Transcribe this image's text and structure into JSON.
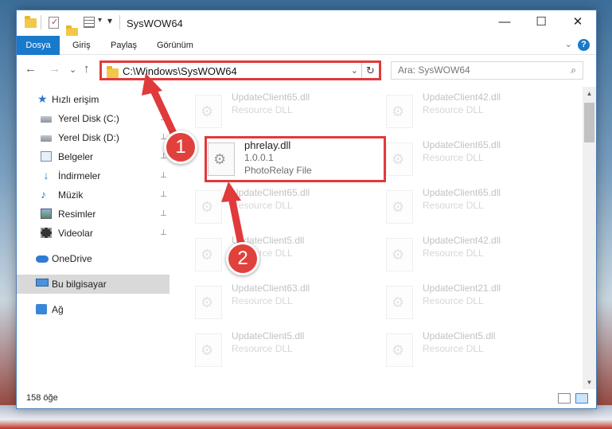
{
  "window": {
    "title": "SysWOW64",
    "minimize_glyph": "—",
    "maximize_glyph": "☐",
    "close_glyph": "✕"
  },
  "ribbon": {
    "tabs": [
      {
        "label": "Dosya",
        "active": true
      },
      {
        "label": "Giriş"
      },
      {
        "label": "Paylaş"
      },
      {
        "label": "Görünüm"
      }
    ],
    "help_glyph": "?",
    "expand_glyph": "⌄"
  },
  "nav": {
    "back_glyph": "←",
    "forward_glyph": "→",
    "recent_glyph": "⌄",
    "up_glyph": "↑"
  },
  "address": {
    "path": "C:\\Windows\\SysWOW64",
    "dropdown_glyph": "⌄",
    "refresh_glyph": "↻"
  },
  "search": {
    "placeholder": "Ara: SysWOW64",
    "icon_glyph": "⌕"
  },
  "sidebar": {
    "items": [
      {
        "label": "Hızlı erişim",
        "icon": "star-icon"
      },
      {
        "label": "Yerel Disk (C:)",
        "icon": "disk-icon",
        "pinned": true
      },
      {
        "label": "Yerel Disk (D:)",
        "icon": "disk-icon",
        "pinned": true
      },
      {
        "label": "Belgeler",
        "icon": "documents-icon",
        "pinned": true
      },
      {
        "label": "İndirmeler",
        "icon": "downloads-icon",
        "pinned": true
      },
      {
        "label": "Müzik",
        "icon": "music-icon",
        "pinned": true
      },
      {
        "label": "Resimler",
        "icon": "pictures-icon",
        "pinned": true
      },
      {
        "label": "Videolar",
        "icon": "videos-icon",
        "pinned": true
      },
      {
        "label": "OneDrive",
        "icon": "onedrive-icon"
      },
      {
        "label": "Bu bilgisayar",
        "icon": "this-pc-icon",
        "selected": true
      },
      {
        "label": "Ağ",
        "icon": "network-icon"
      }
    ],
    "pin_glyph": "📌"
  },
  "files": [
    {
      "name": "UpdateClient65.dll",
      "type": "Resource DLL",
      "faded": true
    },
    {
      "name": "UpdateClient42.dll",
      "type": "Resource DLL",
      "faded": true
    },
    {
      "name": "phrelay.dll",
      "version": "1.0.0.1",
      "type": "PhotoRelay File",
      "faded": false,
      "highlighted": true
    },
    {
      "name": "UpdateClient65.dll",
      "type": "Resource DLL",
      "faded": true
    },
    {
      "name": "UpdateClient65.dll",
      "type": "Resource DLL",
      "faded": true
    },
    {
      "name": "UpdateClient65.dll",
      "type": "Resource DLL",
      "faded": true
    },
    {
      "name": "UpdateClient5.dll",
      "type": "Resource DLL",
      "faded": true
    },
    {
      "name": "UpdateClient42.dll",
      "type": "Resource DLL",
      "faded": true
    },
    {
      "name": "UpdateClient63.dll",
      "type": "Resource DLL",
      "faded": true
    },
    {
      "name": "UpdateClient21.dll",
      "type": "Resource DLL",
      "faded": true
    },
    {
      "name": "UpdateClient5.dll",
      "type": "Resource DLL",
      "faded": true
    },
    {
      "name": "UpdateClient5.dll",
      "type": "Resource DLL",
      "faded": true
    }
  ],
  "status": {
    "item_count": "158 öğe"
  },
  "annotations": {
    "callout_1": "1",
    "callout_2": "2",
    "color": "#e03a3a"
  }
}
